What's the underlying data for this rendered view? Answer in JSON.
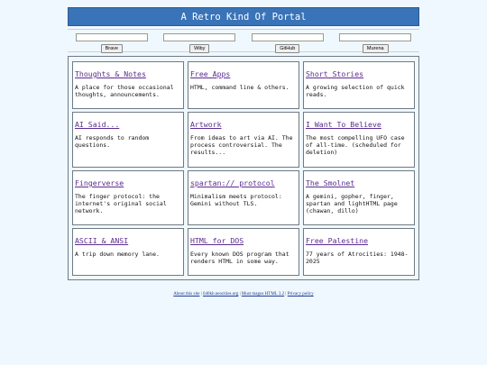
{
  "header": {
    "title": "A Retro Kind Of Portal"
  },
  "search": [
    {
      "label": "Brave"
    },
    {
      "label": "Wiby"
    },
    {
      "label": "GitHub"
    },
    {
      "label": "Murena"
    }
  ],
  "cards": [
    {
      "title": "Thoughts & Notes",
      "desc": "A place for those occasional thoughts, announcements."
    },
    {
      "title": "Free Apps",
      "desc": "HTML, command line & others."
    },
    {
      "title": "Short Stories",
      "desc": "A growing selection of quick reads."
    },
    {
      "title": "AI Said...",
      "desc": "AI responds to random questions."
    },
    {
      "title": "Artwork",
      "desc": "From ideas to art via AI. The process controversial. The results..."
    },
    {
      "title": "I Want To Believe",
      "desc": "The most compelling UFO case of all-time. (scheduled for deletion)"
    },
    {
      "title": "Fingerverse",
      "desc": "The finger protocol: the internet's original social network."
    },
    {
      "title": "spartan:// protocol",
      "desc": "Minimalism meets protocol: Gemini without TLS."
    },
    {
      "title": "The Smolnet",
      "desc": "A gemini, gopher, finger, spartan and lightHTML page (chawan, dillo)"
    },
    {
      "title": "ASCII & ANSI",
      "desc": "A trip down memory lane."
    },
    {
      "title": "HTML for DOS",
      "desc": "Every known DOS program that renders HTML in some way."
    },
    {
      "title": "Free Palestine",
      "desc": "77 years of Atrocities: 1948-2025"
    }
  ],
  "footer": {
    "links": [
      "About this site",
      "640kb.neocities.org",
      "Must magus HTML 3.2",
      "Privacy policy"
    ],
    "separator": "|"
  }
}
